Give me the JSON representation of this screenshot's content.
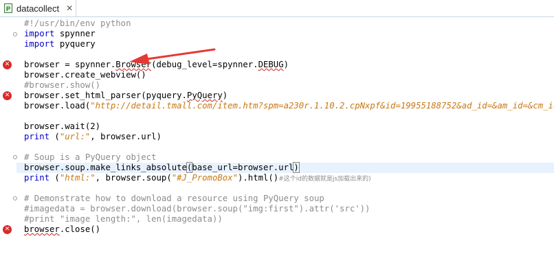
{
  "tab": {
    "title": "datacollect",
    "file_icon_letter": "P",
    "close_glyph": "✕"
  },
  "code": {
    "l1": "#!/usr/bin/env python",
    "l2_kw": "import",
    "l2_rest": " spynner",
    "l3_kw": "import",
    "l3_rest": " pyquery",
    "l5_a": "browser = spynner.",
    "l5_b": "Browser",
    "l5_c": "(debug_level=spynner.",
    "l5_d": "DEBUG",
    "l5_e": ")",
    "l6": "browser.create_webview()",
    "l7": "#browser.show()",
    "l8_a": "browser.set_html_parser(pyquery.",
    "l8_b": "PyQuery",
    "l8_c": ")",
    "l9_a": "browser.load(",
    "l9_b": "\"http://detail.tmall.com/item.htm?spm=a230r.1.10.2.cpNxpf&id=19955188752&ad_id=&am_id=&cm_id=&pm_",
    "l11_a": "browser.wait(",
    "l11_b": "2",
    "l11_c": ")",
    "l12_kw": "print",
    "l12_a": " (",
    "l12_str": "\"url:\"",
    "l12_b": ", browser.url)",
    "l14": "# Soup is a PyQuery object",
    "l15_a": "browser.soup.make_links_absolute",
    "l15_b": "(",
    "l15_c": "base_url=browser.url",
    "l15_d": ")",
    "l16_kw": "print",
    "l16_a": " (",
    "l16_str1": "\"html:\"",
    "l16_b": ", browser.soup(",
    "l16_str2": "\"#J_PromoBox\"",
    "l16_c": ").html()",
    "l16_cm": "#这个id的数据就是js加载出来的)",
    "l18": "# Demonstrate how to download a resource using PyQuery soup",
    "l19": "#imagedata = browser.download(browser.soup(\"img:first\").attr('src'))",
    "l20": "#print \"image length:\", len(imagedata))",
    "l21_a": "browser",
    "l21_b": ".close()"
  },
  "markers": {
    "error_glyph": "✕"
  },
  "colors": {
    "keyword": "#0000cc",
    "comment": "#8c8c8c",
    "string": "#c87814",
    "error": "#d92b2b",
    "arrow": "#e53935"
  }
}
